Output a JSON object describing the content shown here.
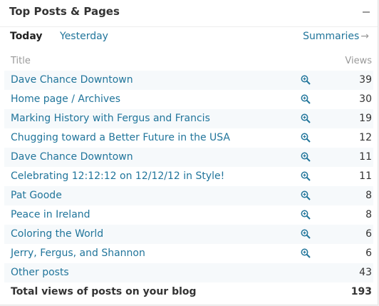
{
  "widget": {
    "title": "Top Posts & Pages"
  },
  "tabs": {
    "today": "Today",
    "yesterday": "Yesterday",
    "summaries": "Summaries",
    "summaries_arrow": "→"
  },
  "table": {
    "headers": {
      "title": "Title",
      "views": "Views"
    },
    "rows": [
      {
        "title": "Dave Chance Downtown",
        "views": "39"
      },
      {
        "title": "Home page / Archives",
        "views": "30"
      },
      {
        "title": "Marking History with Fergus and Francis",
        "views": "19"
      },
      {
        "title": "Chugging toward a Better Future in the USA",
        "views": "12"
      },
      {
        "title": "Dave Chance Downtown",
        "views": "11"
      },
      {
        "title": "Celebrating 12:12:12 on 12/12/12 in Style!",
        "views": "11"
      },
      {
        "title": "Pat Goode",
        "views": "8"
      },
      {
        "title": "Peace in Ireland",
        "views": "8"
      },
      {
        "title": "Coloring the World",
        "views": "6"
      },
      {
        "title": "Jerry, Fergus, and Shannon",
        "views": "6"
      }
    ],
    "other": {
      "title": "Other posts",
      "views": "43"
    },
    "total": {
      "title": "Total views of posts on your blog",
      "views": "193"
    }
  },
  "icons": {
    "collapse": "minus-icon",
    "zoom": "magnifier-plus-icon"
  },
  "colors": {
    "link": "#21759b",
    "alt_row": "#f6f9fb",
    "text": "#333333",
    "muted": "#999999"
  }
}
